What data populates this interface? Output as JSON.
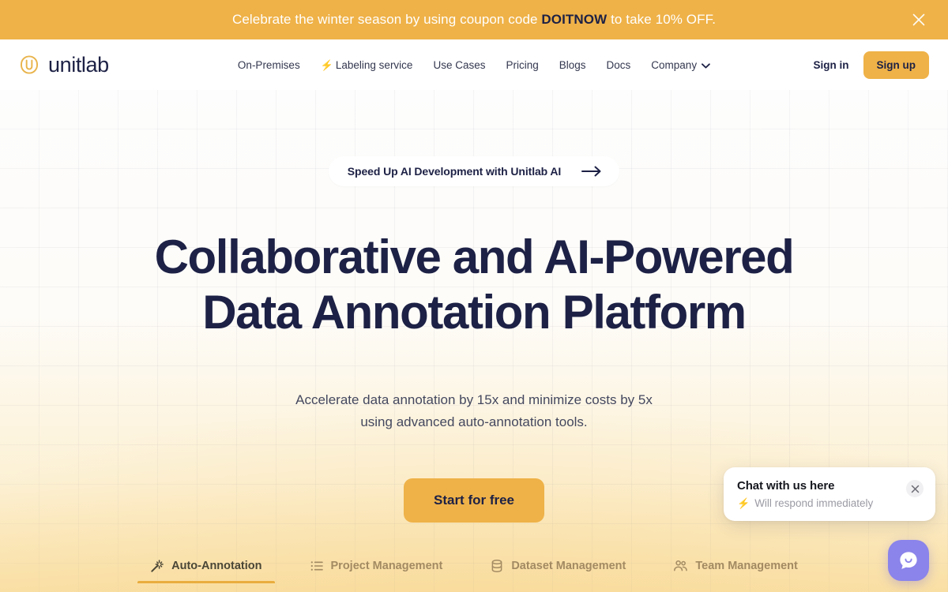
{
  "promo": {
    "text_before": "Celebrate the winter season by using coupon code ",
    "code": "DOITNOW",
    "text_after": " to take 10% OFF.",
    "close_label": "close-banner",
    "bg_color": "#efb248",
    "code_color": "#1d2145"
  },
  "header": {
    "brand_name": "unitlab",
    "nav": [
      {
        "label": "On-Premises",
        "has_bolt": false,
        "has_chevron": false
      },
      {
        "label": "Labeling service",
        "has_bolt": true,
        "has_chevron": false
      },
      {
        "label": "Use Cases",
        "has_bolt": false,
        "has_chevron": false
      },
      {
        "label": "Pricing",
        "has_bolt": false,
        "has_chevron": false
      },
      {
        "label": "Blogs",
        "has_bolt": false,
        "has_chevron": false
      },
      {
        "label": "Docs",
        "has_bolt": false,
        "has_chevron": false
      },
      {
        "label": "Company",
        "has_bolt": false,
        "has_chevron": true
      }
    ],
    "sign_in": "Sign in",
    "sign_up": "Sign up",
    "accent_color": "#efb248"
  },
  "hero": {
    "pill_text": "Speed Up AI Development with Unitlab AI",
    "title_line1": "Collaborative and AI-Powered",
    "title_line2": "Data Annotation Platform",
    "subtitle_line1": "Accelerate data annotation by 15x and minimize costs by 5x",
    "subtitle_line2": "using advanced auto-annotation tools.",
    "cta_label": "Start for free",
    "pill_border_color": "#e8b54b",
    "title_color": "#1d2145"
  },
  "feature_tabs": [
    {
      "label": "Auto-Annotation",
      "icon": "magic-wand-icon",
      "active": true
    },
    {
      "label": "Project Management",
      "icon": "list-icon",
      "active": false
    },
    {
      "label": "Dataset Management",
      "icon": "database-icon",
      "active": false
    },
    {
      "label": "Team Management",
      "icon": "people-icon",
      "active": false
    }
  ],
  "chat_widget": {
    "title": "Chat with us here",
    "subtitle": "Will respond immediately",
    "bolt_color": "#2fbf5c",
    "fab_color": "#8b84ea",
    "close_label": "close-chat-prompt"
  }
}
